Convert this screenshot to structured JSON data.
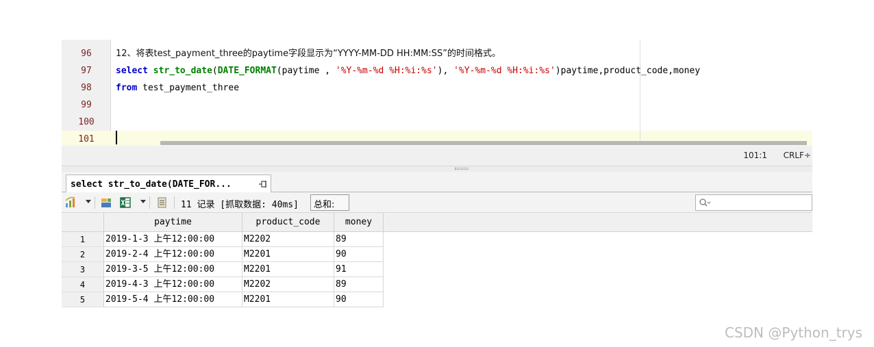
{
  "editor": {
    "line_numbers": [
      "96",
      "97",
      "98",
      "99",
      "100",
      "101"
    ],
    "line96_comment": "12、将表test_payment_three的paytime字段显示为“YYYY-MM-DD HH:MM:SS”的时间格式。",
    "line97": {
      "kw_select": "select",
      "fn_str_to_date": "str_to_date",
      "paren_open": "(",
      "fn_date_format": "DATE_FORMAT",
      "args1": "(paytime , ",
      "str1": "'%Y-%m-%d %H:%i:%s'",
      "args2": "), ",
      "str2": "'%Y-%m-%d %H:%i:%s'",
      "tail": ")paytime,product_code,money"
    },
    "line98": {
      "kw_from": "from",
      "table": " test_payment_three"
    }
  },
  "status": {
    "cursor_pos": "101:1",
    "line_ending": "CRLF÷"
  },
  "result_tab": {
    "label": "select str_to_date(DATE_FOR..."
  },
  "toolbar": {
    "record_info": "11 记录 [抓取数据: 40ms]",
    "sum_label": "总和:",
    "search_placeholder": ""
  },
  "grid": {
    "columns": [
      "paytime",
      "product_code",
      "money"
    ],
    "rows": [
      {
        "num": "1",
        "paytime": "2019-1-3 上午12:00:00",
        "product_code": "M2202",
        "money": "89"
      },
      {
        "num": "2",
        "paytime": "2019-2-4 上午12:00:00",
        "product_code": "M2201",
        "money": "90"
      },
      {
        "num": "3",
        "paytime": "2019-3-5 上午12:00:00",
        "product_code": "M2201",
        "money": "91"
      },
      {
        "num": "4",
        "paytime": "2019-4-3 上午12:00:00",
        "product_code": "M2202",
        "money": "89"
      },
      {
        "num": "5",
        "paytime": "2019-5-4 上午12:00:00",
        "product_code": "M2201",
        "money": "90"
      }
    ]
  },
  "watermark": "CSDN @Python_trys",
  "icons": [
    "refresh-dropdown-icon",
    "export-icon",
    "excel-icon",
    "script-icon",
    "pin-icon",
    "search-icon"
  ],
  "colors": {
    "keyword": "#0000cc",
    "function": "#008000",
    "string": "#c40000",
    "line_number": "#7a1f1f",
    "current_line": "#fcfce2"
  }
}
